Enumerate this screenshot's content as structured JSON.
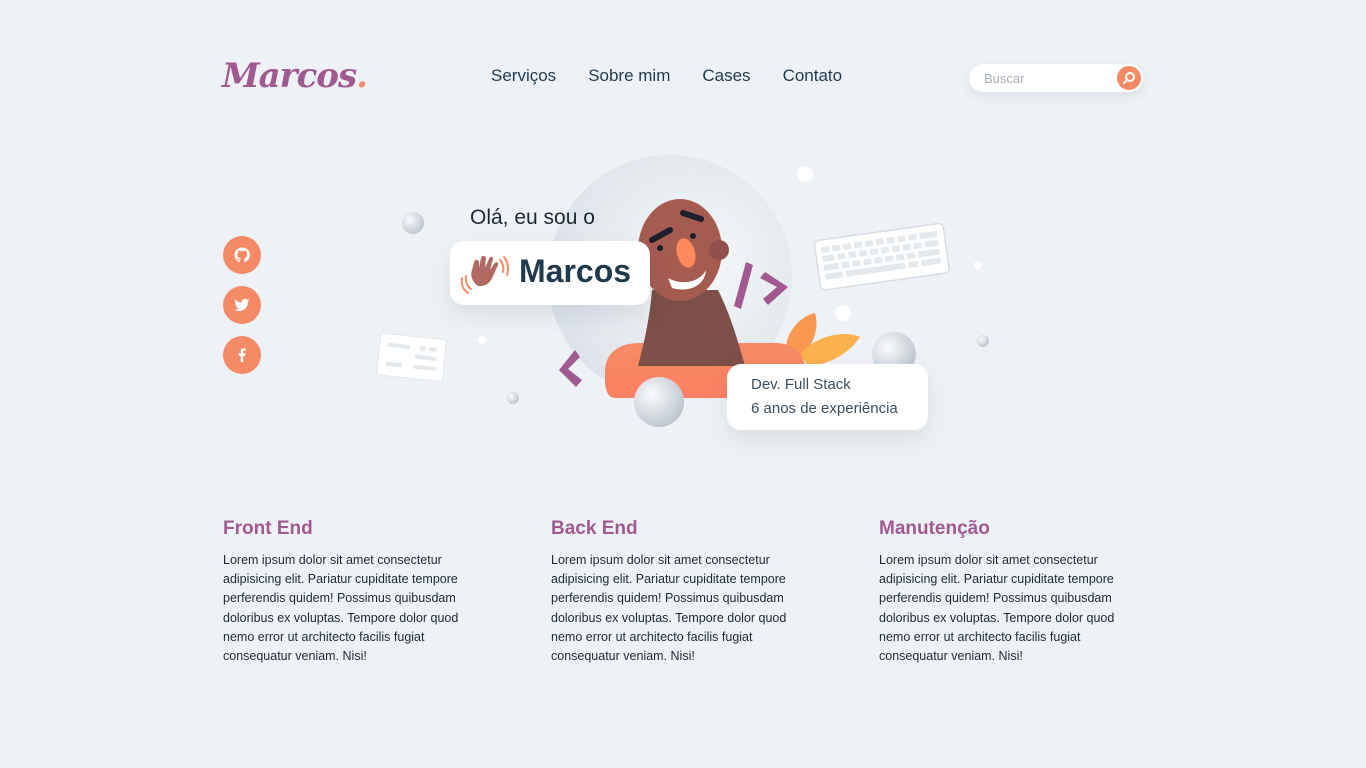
{
  "header": {
    "logo": "Marcos",
    "logo_dot": ".",
    "nav": [
      "Serviços",
      "Sobre mim",
      "Cases",
      "Contato"
    ],
    "search_placeholder": "Buscar"
  },
  "social": [
    "github-icon",
    "twitter-icon",
    "facebook-icon"
  ],
  "hero": {
    "greeting": "Olá, eu sou o",
    "name": "Marcos",
    "role": "Dev. Full Stack",
    "experience": "6 anos de experiência"
  },
  "services": [
    {
      "title": "Front End",
      "text": "Lorem ipsum dolor sit amet consectetur adipisicing elit. Pariatur cupiditate tempore perferendis quidem! Possimus quibusdam doloribus ex voluptas. Tempore dolor quod nemo error ut architecto facilis fugiat consequatur veniam. Nisi!"
    },
    {
      "title": "Back End",
      "text": "Lorem ipsum dolor sit amet consectetur adipisicing elit. Pariatur cupiditate tempore perferendis quidem! Possimus quibusdam doloribus ex voluptas. Tempore dolor quod nemo error ut architecto facilis fugiat consequatur veniam. Nisi!"
    },
    {
      "title": "Manutenção",
      "text": "Lorem ipsum dolor sit amet consectetur adipisicing elit. Pariatur cupiditate tempore perferendis quidem! Possimus quibusdam doloribus ex voluptas. Tempore dolor quod nemo error ut architecto facilis fugiat consequatur veniam. Nisi!"
    }
  ],
  "colors": {
    "background": "#eef2f6",
    "accent": "#f58b66",
    "brand": "#a05a91",
    "text": "#1f3a4d"
  }
}
